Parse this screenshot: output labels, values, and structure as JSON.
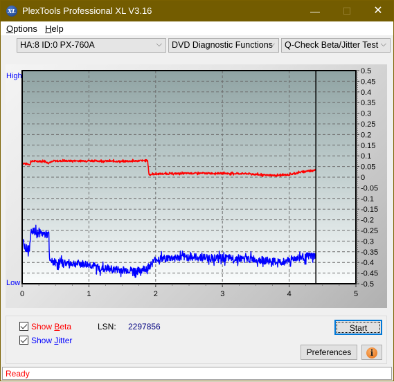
{
  "window": {
    "title": "PlexTools Professional XL V3.16",
    "icon": "xl-app-icon",
    "controls": {
      "minimize": "—",
      "maximize": "☐",
      "close": "✕"
    }
  },
  "menu": {
    "items": [
      {
        "label": "Options",
        "accel": "O"
      },
      {
        "label": "Help",
        "accel": "H"
      }
    ]
  },
  "toolbar": {
    "drive_select": "HA:8 ID:0  PX-760A",
    "function_select": "DVD Diagnostic Functions",
    "test_select": "Q-Check Beta/Jitter Test",
    "dropdown_glyph": "⌵"
  },
  "chart_data": {
    "type": "line",
    "title": "",
    "xlabel": "",
    "ylabel": "",
    "xlim": [
      0,
      5
    ],
    "ylim": [
      -0.5,
      0.5
    ],
    "x_ticks": [
      "0",
      "1",
      "2",
      "3",
      "4",
      "5"
    ],
    "y_ticks": [
      "0.5",
      "0.45",
      "0.4",
      "0.35",
      "0.3",
      "0.25",
      "0.2",
      "0.15",
      "0.1",
      "0.05",
      "0",
      "-0.05",
      "-0.1",
      "-0.15",
      "-0.2",
      "-0.25",
      "-0.3",
      "-0.35",
      "-0.4",
      "-0.45",
      "-0.5"
    ],
    "y_left_labels": {
      "top": "High",
      "bottom": "Low"
    },
    "grid": true,
    "cursor_x": 4.4,
    "series": [
      {
        "name": "Beta",
        "color": "#ff0000",
        "x": [
          0,
          0.12,
          0.13,
          0.35,
          0.37,
          0.45,
          0.47,
          1.0,
          1.5,
          1.85,
          1.88,
          1.9,
          2.0,
          2.5,
          3.0,
          3.4,
          3.6,
          3.8,
          4.0,
          4.2,
          4.4
        ],
        "y": [
          0.065,
          0.06,
          0.075,
          0.075,
          0.068,
          0.072,
          0.076,
          0.077,
          0.074,
          0.078,
          0.078,
          0.012,
          0.015,
          0.018,
          0.018,
          0.016,
          0.01,
          0.008,
          0.012,
          0.025,
          0.035
        ]
      },
      {
        "name": "Jitter",
        "color": "#0000ff",
        "x": [
          0,
          0.05,
          0.1,
          0.12,
          0.13,
          0.2,
          0.3,
          0.4,
          0.41,
          0.5,
          0.8,
          1.0,
          1.2,
          1.5,
          1.75,
          1.9,
          2.0,
          2.2,
          2.5,
          3.0,
          3.5,
          3.7,
          3.9,
          4.0,
          4.2,
          4.4
        ],
        "y": [
          -0.3,
          -0.33,
          -0.34,
          -0.32,
          -0.245,
          -0.26,
          -0.265,
          -0.27,
          -0.395,
          -0.4,
          -0.405,
          -0.41,
          -0.43,
          -0.435,
          -0.44,
          -0.42,
          -0.385,
          -0.38,
          -0.375,
          -0.38,
          -0.385,
          -0.395,
          -0.4,
          -0.385,
          -0.375,
          -0.37
        ]
      }
    ]
  },
  "options": {
    "show_beta": {
      "label": "Show Beta",
      "accel": "B",
      "checked": true,
      "color": "#ff0000"
    },
    "show_jitter": {
      "label": "Show Jitter",
      "accel": "J",
      "checked": true,
      "color": "#0000ff"
    },
    "lsn_label": "LSN:",
    "lsn_value": "2297856"
  },
  "buttons": {
    "start": "Start",
    "preferences": "Preferences",
    "info": "i"
  },
  "status": {
    "text": "Ready",
    "color": "#ff0000"
  }
}
